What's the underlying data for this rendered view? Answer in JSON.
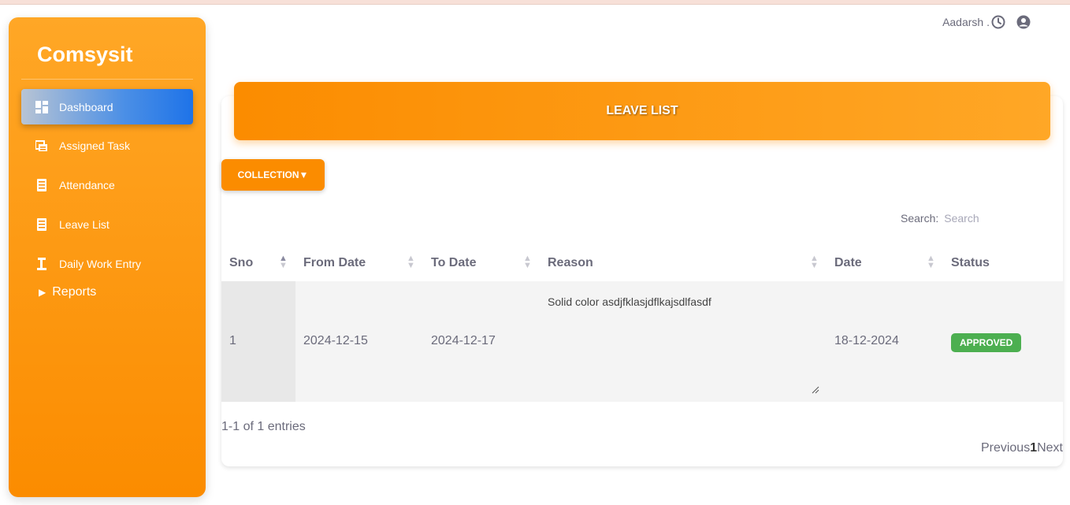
{
  "app": {
    "brand": "Comsysit"
  },
  "user": {
    "name": "Aadarsh ."
  },
  "sidebar": {
    "items": [
      {
        "label": "Dashboard",
        "icon": "dashboard-icon",
        "active": true
      },
      {
        "label": "Assigned Task",
        "icon": "task-icon"
      },
      {
        "label": "Attendance",
        "icon": "attendance-icon"
      },
      {
        "label": "Leave List",
        "icon": "leave-list-icon"
      },
      {
        "label": "Daily Work Entry",
        "icon": "work-entry-icon"
      }
    ],
    "reports_label": "Reports"
  },
  "page": {
    "title": "LEAVE LIST",
    "collection_label": "COLLECTION▼",
    "search_label": "Search:",
    "search_placeholder": "Search"
  },
  "table": {
    "columns": [
      "Sno",
      "From Date",
      "To Date",
      "Reason",
      "Date",
      "Status"
    ],
    "rows": [
      {
        "sno": "1",
        "from_date": "2024-12-15",
        "to_date": "2024-12-17",
        "reason": "Solid color asdjfklasjdflkajsdlfasdf",
        "date": "18-12-2024",
        "status": "APPROVED"
      }
    ]
  },
  "footer": {
    "entries_text": "1-1 of 1 entries",
    "prev_label": "Previous",
    "current_page": "1",
    "next_label": "Next"
  },
  "colors": {
    "sidebar_gradient_top": "#ffa726",
    "sidebar_gradient_bottom": "#fb8c00",
    "active_item": "#1e73e8",
    "approved": "#4caf50"
  }
}
